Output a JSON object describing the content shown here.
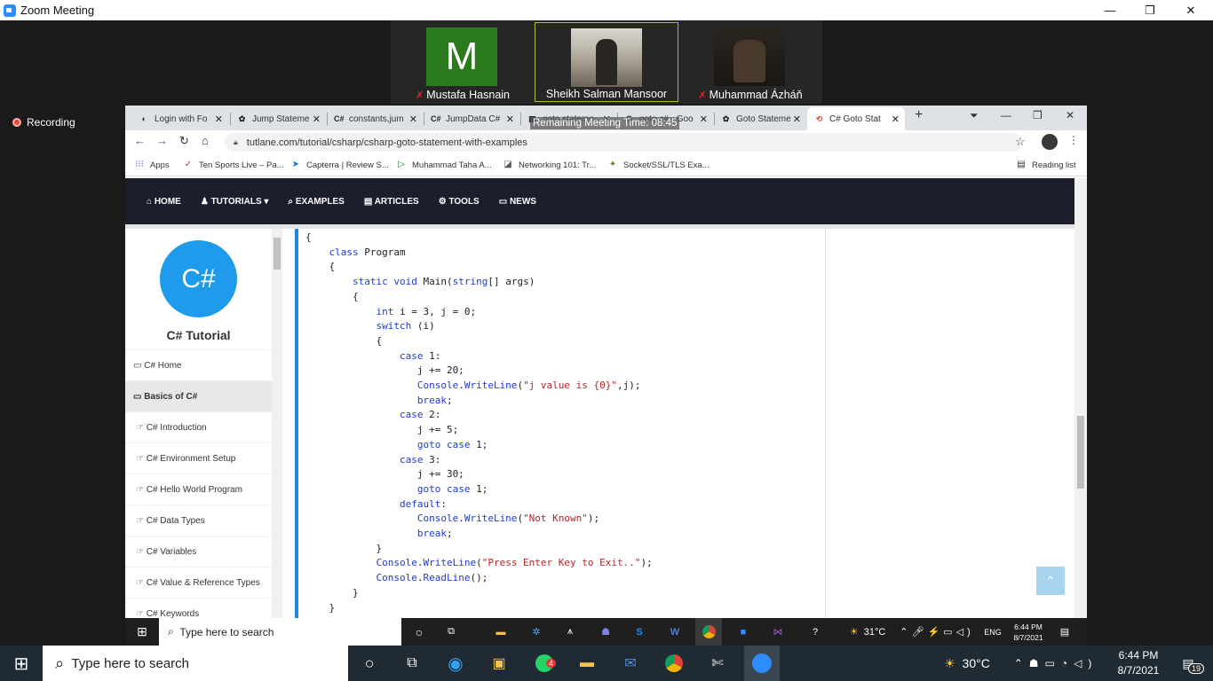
{
  "zoom": {
    "title": "Zoom Meeting",
    "controls": {
      "minimize": "—",
      "maximize": "❐",
      "close": "✕"
    },
    "participants": [
      {
        "initial": "M",
        "name": "Mustafa Hasnain",
        "muted": true
      },
      {
        "name": "Sheikh Salman Mansoor",
        "muted": false
      },
      {
        "name": "Muhammad Ázháň",
        "muted": true
      }
    ],
    "recording_label": "Recording",
    "remaining_time": "Remaining Meeting Time: 08:45"
  },
  "browser": {
    "tabs": [
      {
        "label": "Login with Fo",
        "icon": "◐"
      },
      {
        "label": "Jump Stateme",
        "icon": "✿"
      },
      {
        "label": "constants,jum",
        "icon": "C#"
      },
      {
        "label": "JumpData C#",
        "icon": "C#"
      },
      {
        "label": "goto stateme",
        "icon": "▦"
      },
      {
        "label": "goto c# - Goo",
        "icon": "G"
      },
      {
        "label": "Goto Stateme",
        "icon": "✿"
      },
      {
        "label": "C# Goto Stat",
        "icon": "⟲",
        "active": true
      }
    ],
    "new_tab": "+",
    "window_controls": {
      "minimize": "—",
      "maximize": "❐",
      "close": "✕"
    },
    "url": "tutlane.com/tutorial/csharp/csharp-goto-statement-with-examples",
    "bookmarks": [
      {
        "label": "Apps",
        "icon": "⁝⁝⁝"
      },
      {
        "label": "Ten Sports Live – Pa...",
        "icon": "✓"
      },
      {
        "label": "Capterra | Review S...",
        "icon": "➤"
      },
      {
        "label": "Muhammad Taha A...",
        "icon": "▷"
      },
      {
        "label": "Networking 101: Tr...",
        "icon": "◪"
      },
      {
        "label": "Socket/SSL/TLS Exa...",
        "icon": "✦"
      }
    ],
    "reading_list": "Reading list"
  },
  "site": {
    "nav": [
      "HOME",
      "TUTORIALS ▾",
      "EXAMPLES",
      "ARTICLES",
      "TOOLS",
      "NEWS"
    ],
    "nav_icons": [
      "⌂",
      "♟",
      "⌕",
      "▤",
      "⚙",
      "▭"
    ],
    "logo": "C#",
    "sidebar_title": "C# Tutorial",
    "sidebar_items": [
      {
        "label": "C# Home",
        "icon": "▭",
        "kind": "top"
      },
      {
        "label": "Basics of C#",
        "icon": "▭",
        "kind": "section"
      },
      {
        "label": "C# Introduction",
        "icon": "☞",
        "kind": "sub"
      },
      {
        "label": "C# Environment Setup",
        "icon": "☞",
        "kind": "sub"
      },
      {
        "label": "C# Hello World Program",
        "icon": "☞",
        "kind": "sub"
      },
      {
        "label": "C# Data Types",
        "icon": "☞",
        "kind": "sub"
      },
      {
        "label": "C# Variables",
        "icon": "☞",
        "kind": "sub"
      },
      {
        "label": "C# Value & Reference Types",
        "icon": "☞",
        "kind": "sub"
      },
      {
        "label": "C# Keywords",
        "icon": "☞",
        "kind": "sub"
      }
    ],
    "back_to_top": "⌃",
    "code_lines": [
      [
        "{",
        null
      ],
      [
        "    ",
        [
          [
            "kw",
            "class"
          ],
          [
            "t",
            " Program"
          ]
        ]
      ],
      [
        "    {",
        null
      ],
      [
        "        ",
        [
          [
            "kw",
            "static"
          ],
          [
            "t",
            " "
          ],
          [
            "kw",
            "void"
          ],
          [
            "t",
            " Main("
          ],
          [
            "kw",
            "string"
          ],
          [
            "t",
            "[] args)"
          ]
        ]
      ],
      [
        "        {",
        null
      ],
      [
        "            ",
        [
          [
            "kw",
            "int"
          ],
          [
            "t",
            " i = 3, j = 0;"
          ]
        ]
      ],
      [
        "            ",
        [
          [
            "kw",
            "switch"
          ],
          [
            "t",
            " (i)"
          ]
        ]
      ],
      [
        "            {",
        null
      ],
      [
        "                ",
        [
          [
            "kw",
            "case"
          ],
          [
            "t",
            " 1:"
          ]
        ]
      ],
      [
        "                   j += 20;",
        null
      ],
      [
        "                   ",
        [
          [
            "kw",
            "Console"
          ],
          [
            "t",
            "."
          ],
          [
            "kw",
            "WriteLine"
          ],
          [
            "t",
            "("
          ],
          [
            "str",
            "\"j value is {0}\""
          ],
          [
            "t",
            ",j);"
          ]
        ]
      ],
      [
        "                   ",
        [
          [
            "kw",
            "break"
          ],
          [
            "t",
            ";"
          ]
        ]
      ],
      [
        "                ",
        [
          [
            "kw",
            "case"
          ],
          [
            "t",
            " 2:"
          ]
        ]
      ],
      [
        "                   j += 5;",
        null
      ],
      [
        "                   ",
        [
          [
            "kw",
            "goto"
          ],
          [
            "t",
            " "
          ],
          [
            "kw",
            "case"
          ],
          [
            "t",
            " 1;"
          ]
        ]
      ],
      [
        "                ",
        [
          [
            "kw",
            "case"
          ],
          [
            "t",
            " 3:"
          ]
        ]
      ],
      [
        "                   j += 30;",
        null
      ],
      [
        "                   ",
        [
          [
            "kw",
            "goto"
          ],
          [
            "t",
            " "
          ],
          [
            "kw",
            "case"
          ],
          [
            "t",
            " 1;"
          ]
        ]
      ],
      [
        "                ",
        [
          [
            "kw",
            "default"
          ],
          [
            "t",
            ":"
          ]
        ]
      ],
      [
        "                   ",
        [
          [
            "kw",
            "Console"
          ],
          [
            "t",
            "."
          ],
          [
            "kw",
            "WriteLine"
          ],
          [
            "t",
            "("
          ],
          [
            "str",
            "\"Not Known\""
          ],
          [
            "t",
            ");"
          ]
        ]
      ],
      [
        "                   ",
        [
          [
            "kw",
            "break"
          ],
          [
            "t",
            ";"
          ]
        ]
      ],
      [
        "            }",
        null
      ],
      [
        "            ",
        [
          [
            "kw",
            "Console"
          ],
          [
            "t",
            "."
          ],
          [
            "kw",
            "WriteLine"
          ],
          [
            "t",
            "("
          ],
          [
            "str",
            "\"Press Enter Key to Exit..\""
          ],
          [
            "t",
            ");"
          ]
        ]
      ],
      [
        "            ",
        [
          [
            "kw",
            "Console"
          ],
          [
            "t",
            "."
          ],
          [
            "kw",
            "ReadLine"
          ],
          [
            "t",
            "();"
          ]
        ]
      ],
      [
        "        }",
        null
      ],
      [
        "    }",
        null
      ]
    ]
  },
  "inner_taskbar": {
    "search_placeholder": "Type here to search",
    "weather": "31°C",
    "lang": "ENG",
    "time": "6:44 PM",
    "date": "8/7/2021"
  },
  "taskbar": {
    "search_placeholder": "Type here to search",
    "weather": "30°C",
    "time": "6:44 PM",
    "date": "8/7/2021",
    "notification_count": "19",
    "whatsapp_badge": "4"
  }
}
